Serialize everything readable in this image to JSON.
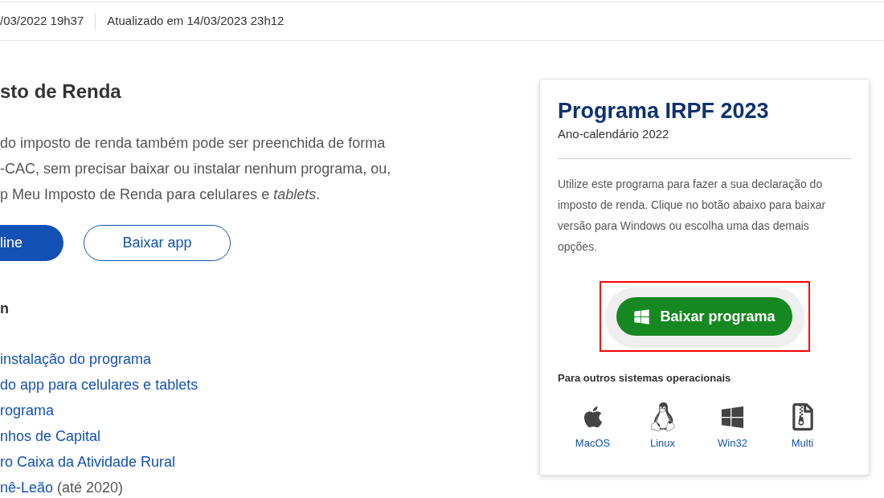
{
  "meta_bar": {
    "published": "/03/2022 19h37",
    "updated": "Atualizado em 14/03/2023 23h12"
  },
  "article": {
    "title": "sto de Renda",
    "intro_lines": [
      "do imposto de renda também pode ser preenchida de forma",
      "-CAC, sem precisar baixar ou instalar nenhum programa, ou,",
      "p Meu Imposto de Renda para celulares e *tablets*."
    ],
    "buttons": [
      {
        "label": "line",
        "kind": "primary"
      },
      {
        "label": "Baixar app",
        "kind": "outline"
      }
    ],
    "section_heading": "n",
    "links": [
      {
        "label": "instalação do programa"
      },
      {
        "label": "do app para celulares e tablets"
      },
      {
        "label": "rograma"
      },
      {
        "label": "nhos de Capital"
      },
      {
        "label": "ro Caixa da Atividade Rural"
      },
      {
        "label": "nê-Leão",
        "note": "(até 2020)"
      }
    ]
  },
  "download_card": {
    "title": "Programa IRPF 2023",
    "subtitle": "Ano-calendário 2022",
    "description": "Utilize este programa para fazer a sua declaração do imposto de renda. Clique no botão abaixo para baixar versão para Windows ou escolha uma das demais opções.",
    "download_button": {
      "label": "Baixar programa",
      "highlighted": true
    },
    "other_os_heading": "Para outros sistemas operacionais",
    "other_os": [
      {
        "label": "MacOS",
        "kind": "apple"
      },
      {
        "label": "Linux",
        "kind": "penguin"
      },
      {
        "label": "Win32",
        "kind": "panes"
      },
      {
        "label": "Multi",
        "kind": "zipfile"
      }
    ]
  }
}
